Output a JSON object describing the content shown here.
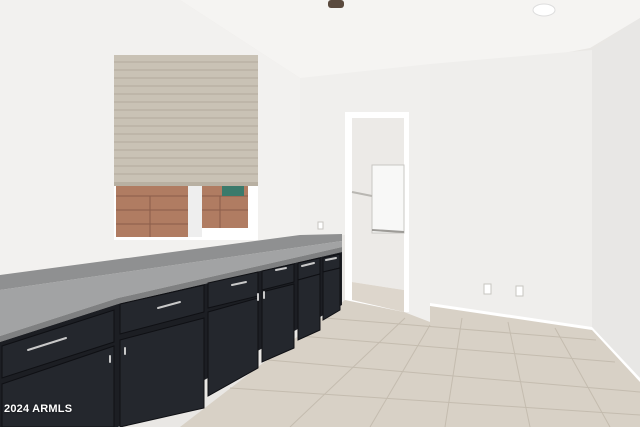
{
  "photo": {
    "subject": "interior-kitchenette",
    "colors": {
      "wall": "#f1f0ee",
      "ceiling": "#f6f5f3",
      "cabinet": "#1d1f24",
      "countertop": "#9c9d9e",
      "floor_tile": "#d9d2c8",
      "shade": "#c8c1b4"
    }
  },
  "watermark": {
    "text": "2024 ARMLS"
  }
}
